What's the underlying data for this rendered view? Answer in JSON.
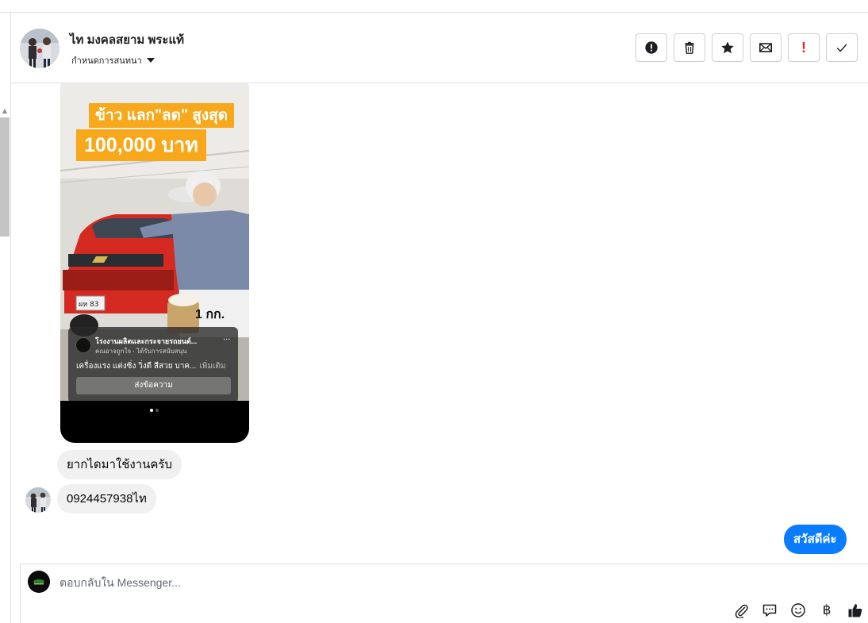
{
  "header": {
    "contact_name": "ไท มงคลสยาม พระแท้",
    "assign_label": "กำหนดการสนทนา",
    "actions": [
      {
        "name": "report-button",
        "icon": "exclamation-circle-icon"
      },
      {
        "name": "delete-button",
        "icon": "trash-icon"
      },
      {
        "name": "star-button",
        "icon": "star-icon"
      },
      {
        "name": "mark-unread-button",
        "icon": "envelope-icon"
      },
      {
        "name": "follow-up-button",
        "icon": "red-exclamation-icon"
      },
      {
        "name": "mark-done-button",
        "icon": "checkmark-icon"
      }
    ]
  },
  "media": {
    "banner_line1": "ข้าว แลก\"ลด\" สูงสุด",
    "banner_line2": "100,000 บาท",
    "ad_title": "โรงงานผลิตและกระจายรถยนต์...",
    "ad_more": "...",
    "ad_subtitle": "คณอาจถูกใจ · ได้รับการสนับสนุน",
    "ad_description": "เครื่องแรง แต่งซิ่ง วิ่งดี สีสวย บาค...",
    "ad_see_more": "เพิ่มเติม",
    "ad_button": "ส่งข้อความ",
    "rice_label": "1 กก.",
    "plate_label": "ผห 83"
  },
  "messages": {
    "incoming": [
      "ยากไดมาใช้งานครับ",
      "0924457938ไท"
    ],
    "outgoing": "สวัสดีค่ะ"
  },
  "composer": {
    "placeholder": "ตอบกลับใน Messenger...",
    "tools": [
      "paperclip-icon",
      "chat-bubble-icon",
      "smiley-icon",
      "baht-icon",
      "thumbs-up-icon"
    ],
    "baht_symbol": "฿"
  },
  "colors": {
    "accent_blue": "#0a7cff",
    "banner_orange": "#f7a81b",
    "incoming_bubble": "#f0f0f0",
    "alert_red": "#e0241a"
  }
}
